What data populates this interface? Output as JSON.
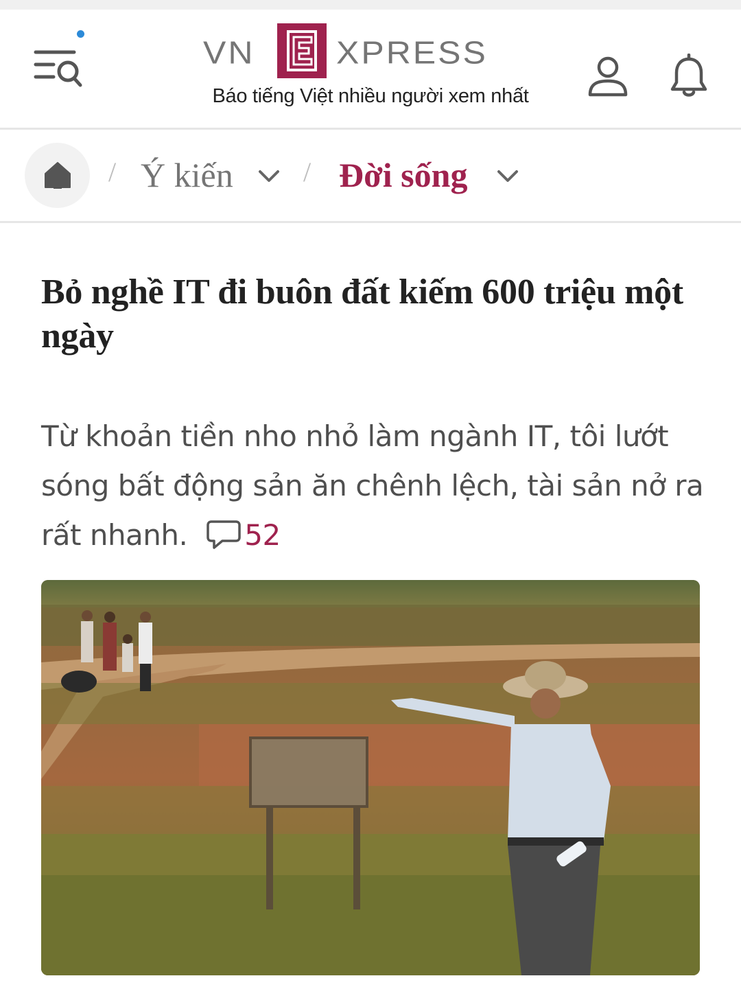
{
  "header": {
    "logo_left": "VN",
    "logo_mid": "E",
    "logo_right": "XPRESS",
    "tagline": "Báo tiếng Việt nhiều người xem nhất"
  },
  "breadcrumb": {
    "separator": "/",
    "items": [
      {
        "label": "Ý kiến"
      },
      {
        "label": "Đời sống"
      }
    ]
  },
  "article": {
    "title": "Bỏ nghề IT đi buôn đất kiếm 600 triệu một ngày",
    "lead": "Từ khoản tiền nho nhỏ làm ngành IT, tôi lướt sóng bất động sản ăn chênh lệch, tài sản nở ra rất nhanh.",
    "comment_count": "52"
  },
  "colors": {
    "brand": "#9f224e",
    "notification_dot": "#2c8ad8",
    "text": "#222222",
    "muted": "#757575"
  },
  "icons": [
    "menu-search-icon",
    "user-icon",
    "bell-icon",
    "home-icon",
    "chevron-down-icon",
    "comment-icon"
  ]
}
